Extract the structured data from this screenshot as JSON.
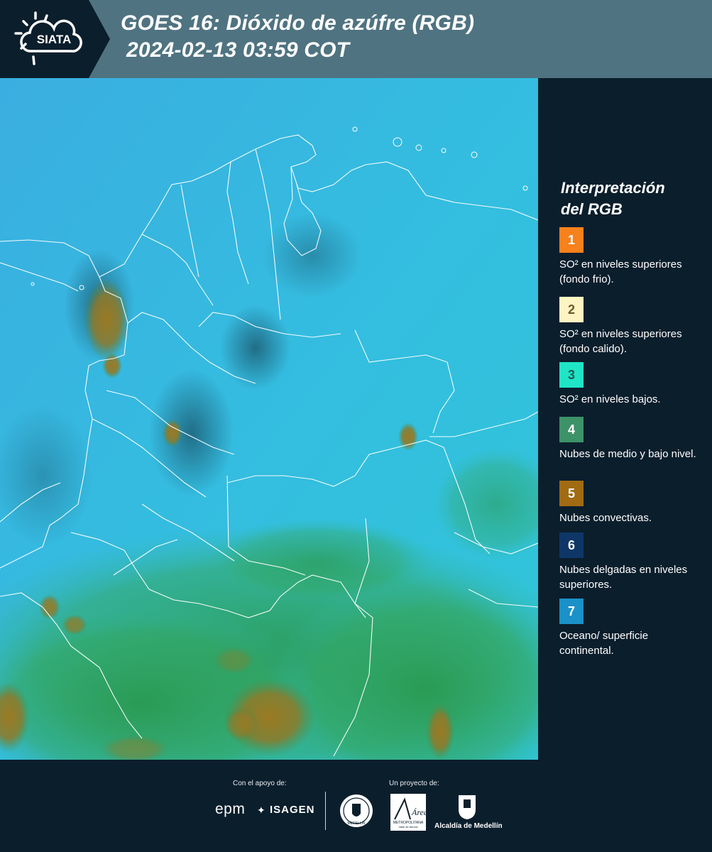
{
  "header": {
    "brand": "SIATA",
    "title_line1": "GOES 16: Dióxido de azúfre (RGB)",
    "title_line2": "2024-02-13 03:59 COT"
  },
  "legend": {
    "title_line1": "Interpretación",
    "title_line2": "del RGB",
    "items": [
      {
        "number": "1",
        "color": "#f7811c",
        "text": "SO² en niveles superiores (fondo frio)."
      },
      {
        "number": "2",
        "color": "#fdf4c2",
        "text": "SO² en niveles superiores (fondo calido)."
      },
      {
        "number": "3",
        "color": "#1fe5c6",
        "text": "SO² en niveles bajos."
      },
      {
        "number": "4",
        "color": "#3d9268",
        "text": "Nubes de medio y bajo nivel."
      },
      {
        "number": "5",
        "color": "#a06b13",
        "text": "Nubes convectivas."
      },
      {
        "number": "6",
        "color": "#0e3768",
        "text": "Nubes delgadas en niveles superiores."
      },
      {
        "number": "7",
        "color": "#1a91c8",
        "text": "Oceano/ superficie continental."
      }
    ]
  },
  "footer": {
    "support_label": "Con el apoyo de:",
    "project_label": "Un proyecto de:",
    "sponsors": [
      "epm",
      "ISAGEN"
    ],
    "partners": [
      "MEDELLIN",
      "Área",
      "METROPOLITANA",
      "Valle de Aburrá",
      "Alcaldía de Medellín"
    ]
  },
  "colors": {
    "header_bg": "#4f7381",
    "dark_bg": "#0b1e2c",
    "ocean": "#36b4de",
    "vegetation": "#2e9a5c",
    "convective": "#a07a2a"
  }
}
